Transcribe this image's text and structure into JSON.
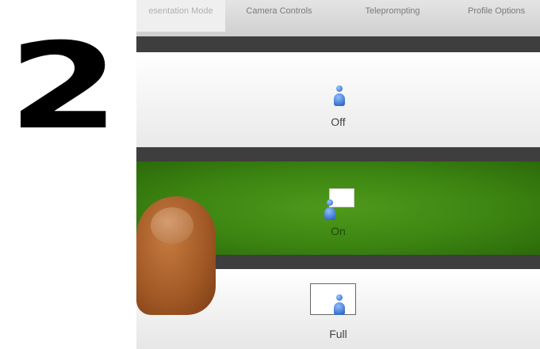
{
  "step_number": "2",
  "tabs": [
    {
      "label": "esentation Mode",
      "active": true
    },
    {
      "label": "Camera Controls",
      "active": false
    },
    {
      "label": "Teleprompting",
      "active": false
    },
    {
      "label": "Profile Options",
      "active": false
    }
  ],
  "options": [
    {
      "label": "Off",
      "icon": "person-icon",
      "selected": false
    },
    {
      "label": "On",
      "icon": "person-with-pip-icon",
      "selected": true
    },
    {
      "label": "Full",
      "icon": "person-in-frame-icon",
      "selected": false
    }
  ],
  "colors": {
    "selected_option": "#3d8512",
    "divider": "#3e3e3e"
  }
}
